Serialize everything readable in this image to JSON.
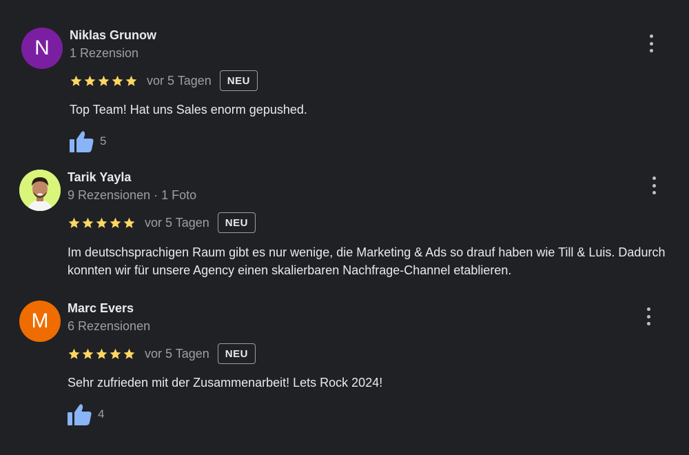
{
  "colors": {
    "background": "#202124",
    "star": "#fdd663",
    "thumb": "#8ab4f8"
  },
  "reviews": [
    {
      "avatar_letter": "N",
      "avatar_color": "#7b1fa2",
      "name": "Niklas Grunow",
      "meta": "1 Rezension",
      "rating": 5,
      "date": "vor 5 Tagen",
      "badge": "NEU",
      "text": "Top Team! Hat uns Sales enorm gepushed.",
      "likes": "5"
    },
    {
      "avatar_letter": "",
      "avatar_color": "#d9f57a",
      "name": "Tarik Yayla",
      "meta": "9 Rezensionen · 1 Foto",
      "rating": 5,
      "date": "vor 5 Tagen",
      "badge": "NEU",
      "text": "Im deutschsprachigen Raum gibt es nur wenige, die Marketing & Ads so drauf haben wie Till & Luis. Dadurch konnten wir für unsere Agency einen skalierbaren Nachfrage-Channel etablieren.",
      "likes": ""
    },
    {
      "avatar_letter": "M",
      "avatar_color": "#ef6c00",
      "name": "Marc Evers",
      "meta": "6 Rezensionen",
      "rating": 5,
      "date": "vor 5 Tagen",
      "badge": "NEU",
      "text": "Sehr zufrieden mit der Zusammenarbeit! Lets Rock 2024!",
      "likes": "4"
    }
  ]
}
